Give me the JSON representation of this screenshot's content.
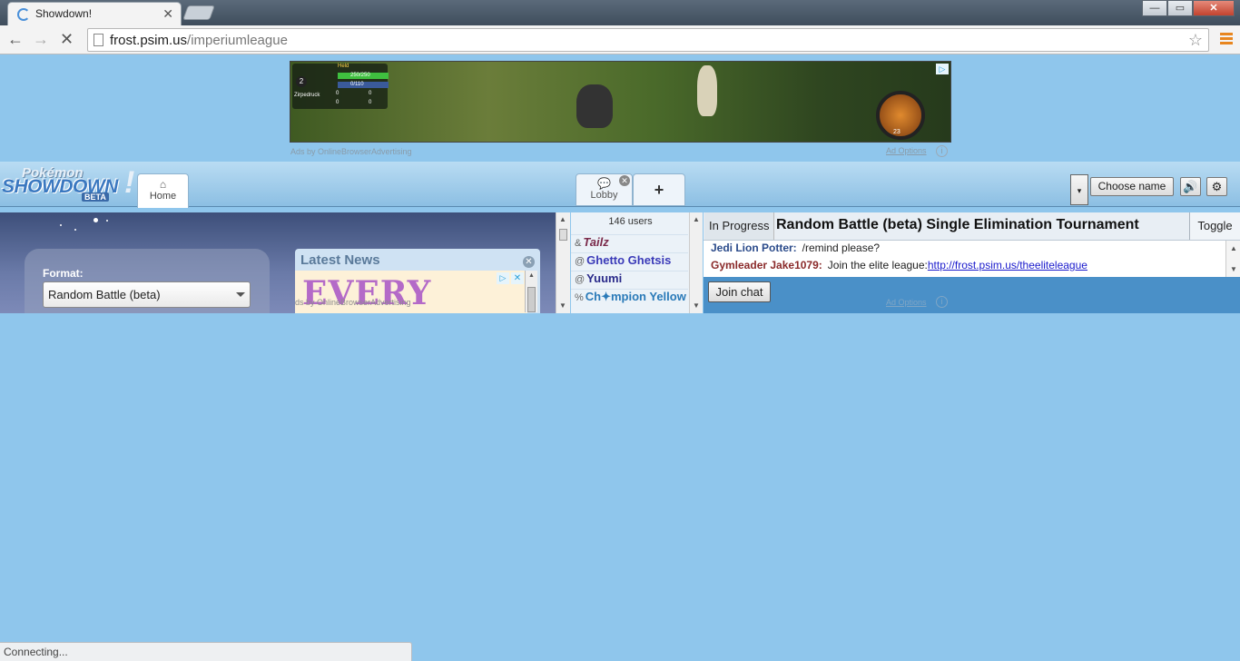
{
  "browser": {
    "tab_title": "Showdown!",
    "tab_close": "✕",
    "url_host": "frost.psim.us",
    "url_path": "/imperiumleague",
    "back_icon": "←",
    "forward_icon": "→",
    "stop_icon": "✕",
    "star_icon": "☆",
    "window_controls": [
      "—",
      "▭",
      "✕"
    ],
    "status_text": "Connecting..."
  },
  "ad_banner": {
    "caption": "Ads by OnlineBrowserAdvertising",
    "options_label": "Ad Options",
    "info_icon": "i",
    "adchoices_icon": "▷",
    "hud_level": "2",
    "hud_name": "Held",
    "hud_hp": "250/250",
    "hud_mp": "0/110",
    "hud_player": "Zirpedruck",
    "hud_counts": [
      "0",
      "0",
      "0",
      "0"
    ],
    "hud_badge": "23"
  },
  "header": {
    "logo_pokemon": "Pokémon",
    "logo_showdown": "SHOWDOWN",
    "logo_beta": "BETA",
    "logo_bang": "!",
    "home_label": "Home",
    "home_icon": "⌂",
    "lobby_label": "Lobby",
    "lobby_icon": "💬",
    "lobby_close": "✕",
    "plus_label": "+",
    "dropdown_icon": "▾",
    "choose_name": "Choose name",
    "sound_icon": "🔊",
    "settings_icon": "⚙"
  },
  "home": {
    "format_label": "Format:",
    "format_value": "Random Battle (beta)",
    "news_title": "Latest News",
    "news_close": "✕",
    "news_ad_text": "EVERY",
    "news_ad_caption": "ds by OnlineBrowserAdvertising",
    "news_ad_adchoices": "▷",
    "news_ad_x": "✕"
  },
  "userlist": {
    "count": "146 users",
    "users": [
      {
        "rank": "&",
        "name": "Tailz",
        "color": "#7a2a4a",
        "italic": true
      },
      {
        "rank": "@",
        "name": "Ghetto Ghetsis",
        "color": "#3a3ab8",
        "italic": false
      },
      {
        "rank": "@",
        "name": "Yuumi",
        "color": "#2a2a8a",
        "italic": false
      },
      {
        "rank": "%",
        "name": "Ch✦mpion Yellow",
        "color": "#2a7ab8",
        "italic": false
      }
    ]
  },
  "tournament": {
    "status": "In Progress",
    "title": "Random Battle (beta) Single Elimination Tournament",
    "toggle": "Toggle"
  },
  "chat": {
    "lines": [
      {
        "user": "Jedi Lion Potter:",
        "user_color": "#2a4a8a",
        "message": "/remind please?",
        "link": ""
      },
      {
        "user": "Gymleader Jake1079:",
        "user_color": "#8a2a2a",
        "message": "Join the elite league:",
        "link": "http://frost.psim.us/theeliteleague"
      }
    ],
    "join_label": "Join chat",
    "ad_options": "Ad Options",
    "ad_info": "i"
  },
  "colors": {
    "page_bg": "#8fc6ec",
    "header_bg": "#b9dcf3",
    "chat_bottom": "#4a90c8"
  }
}
